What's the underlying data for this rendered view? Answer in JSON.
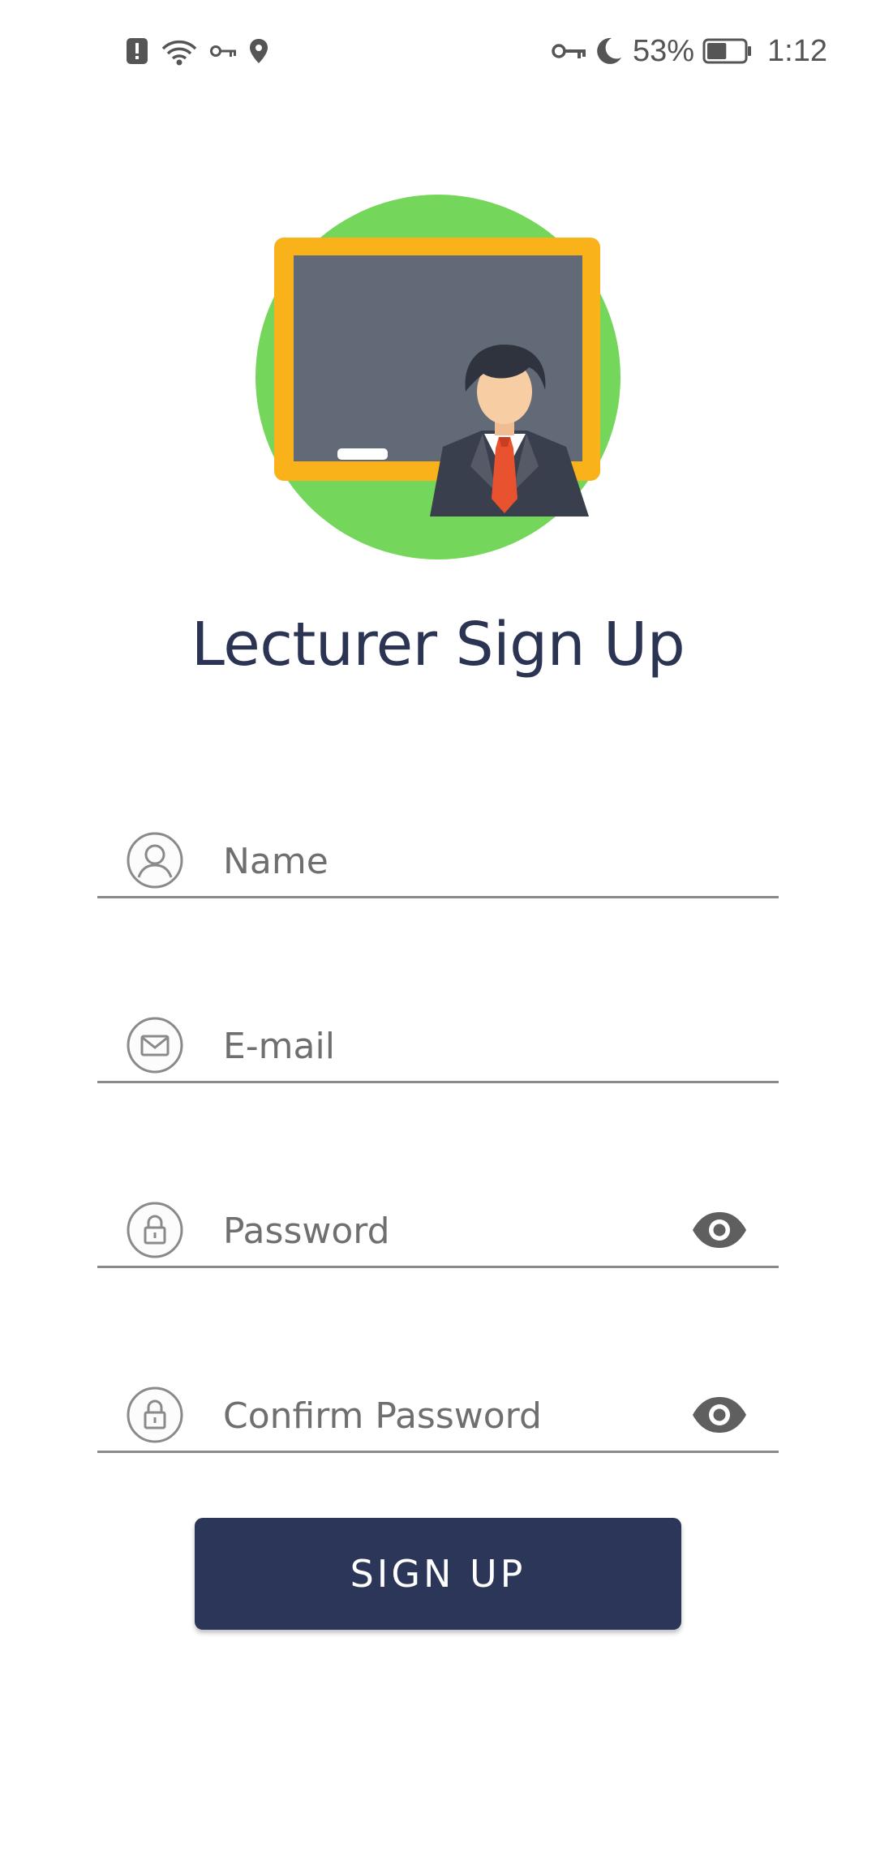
{
  "status_bar": {
    "left_icons": [
      "alert-icon",
      "wifi-icon",
      "key-icon",
      "location-icon"
    ],
    "right_icons": [
      "vpn-key-icon",
      "moon-icon",
      "battery-icon"
    ],
    "battery_percent": "53%",
    "battery_level": 0.53,
    "time": "1:12"
  },
  "colors": {
    "primary": "#2b3658",
    "title": "#2b3553",
    "illustration_circle": "#74d65a",
    "board_frame": "#f9b21a",
    "board": "#626977",
    "tie": "#e8522e"
  },
  "title": "Lecturer Sign Up",
  "form": {
    "name": {
      "placeholder": "Name",
      "value": "",
      "icon": "person-icon"
    },
    "email": {
      "placeholder": "E-mail",
      "value": "",
      "icon": "envelope-icon"
    },
    "password": {
      "placeholder": "Password",
      "value": "",
      "icon": "lock-icon",
      "toggle_icon": "eye-icon"
    },
    "confirm_password": {
      "placeholder": "Confirm Password",
      "value": "",
      "icon": "lock-icon",
      "toggle_icon": "eye-icon"
    }
  },
  "submit_label": "SIGN UP"
}
